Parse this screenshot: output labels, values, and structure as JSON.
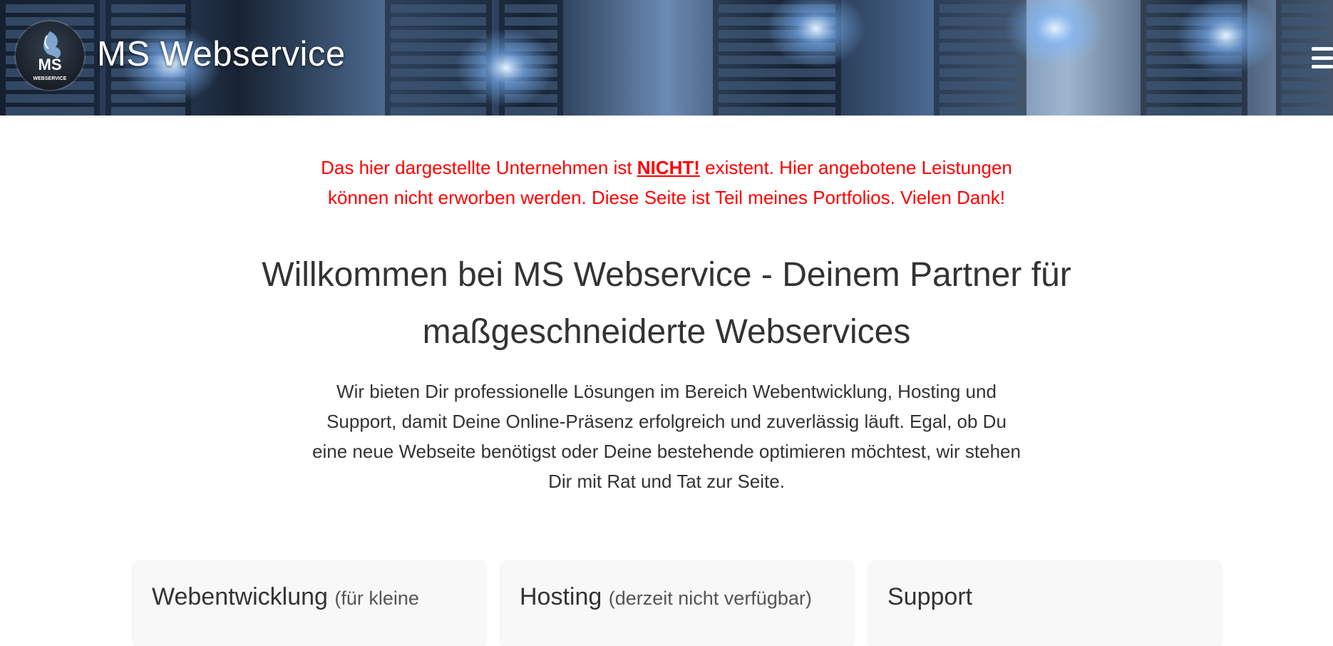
{
  "header": {
    "brand": "MS Webservice",
    "logo_text_top": "MS",
    "logo_text_bottom": "WEBSERVICE",
    "menu_icon": "hamburger-menu-icon"
  },
  "disclaimer": {
    "part1": "Das hier dargestellte Unternehmen ist ",
    "emphasis": "NICHT!",
    "part2": " existent. Hier angebotene Leistungen können nicht erworben werden. Diese Seite ist Teil meines Portfolios. Vielen Dank!"
  },
  "welcome": {
    "title": "Willkommen bei MS Webservice - Deinem Partner für maßgeschneiderte Webservices",
    "intro": "Wir bieten Dir professionelle Lösungen im Bereich Webentwicklung, Hosting und Support, damit Deine Online-Präsenz erfolgreich und zuverlässig läuft. Egal, ob Du eine neue Webseite benötigst oder Deine bestehende optimieren möchtest, wir stehen Dir mit Rat und Tat zur Seite."
  },
  "cards": [
    {
      "title": "Webentwicklung",
      "subtitle": "(für kleine"
    },
    {
      "title": "Hosting",
      "subtitle": "(derzeit nicht verfügbar)"
    },
    {
      "title": "Support",
      "subtitle": ""
    }
  ],
  "colors": {
    "disclaimer": "#ff0000",
    "text": "#333333",
    "card_bg": "#f8f8f8"
  }
}
